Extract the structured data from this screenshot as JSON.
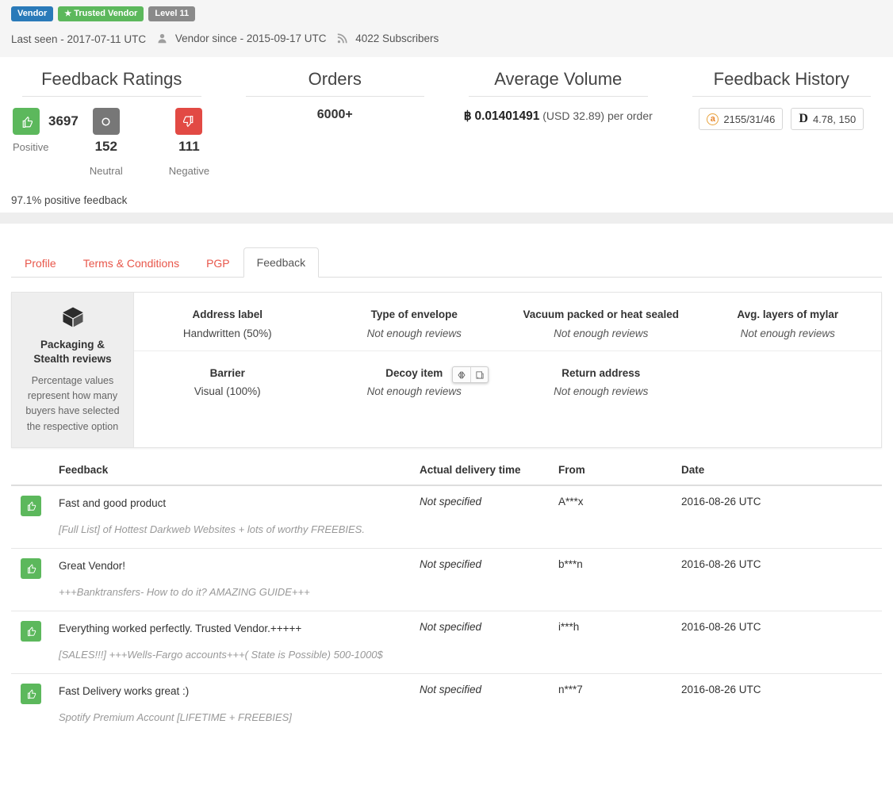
{
  "header": {
    "badges": [
      {
        "label": "Vendor",
        "kind": "vendor"
      },
      {
        "label": "Trusted Vendor",
        "kind": "trusted"
      },
      {
        "label": "Level 11",
        "kind": "level"
      }
    ],
    "last_seen": "Last seen - 2017-07-11 UTC",
    "vendor_since": "Vendor since - 2015-09-17 UTC",
    "subscribers": "4022 Subscribers"
  },
  "stats": {
    "feedback_ratings": {
      "title": "Feedback Ratings",
      "positive_count": "3697",
      "positive_label": "Positive",
      "neutral_count": "152",
      "neutral_label": "Neutral",
      "negative_count": "111",
      "negative_label": "Negative",
      "summary": "97.1% positive feedback"
    },
    "orders": {
      "title": "Orders",
      "value": "6000+"
    },
    "average_volume": {
      "title": "Average Volume",
      "btc_symbol": "฿",
      "btc_amount": "0.01401491",
      "usd": "(USD 32.89) per order"
    },
    "feedback_history": {
      "title": "Feedback History",
      "entries": [
        {
          "market": "a",
          "value": "2155/31/46"
        },
        {
          "market": "D",
          "value": "4.78, 150"
        }
      ]
    }
  },
  "tabs": [
    {
      "label": "Profile",
      "active": false
    },
    {
      "label": "Terms & Conditions",
      "active": false
    },
    {
      "label": "PGP",
      "active": false
    },
    {
      "label": "Feedback",
      "active": true
    }
  ],
  "packaging": {
    "side_title": "Packaging & Stealth reviews",
    "side_desc": "Percentage values represent how many buyers have selected the respective option",
    "row1": [
      {
        "head": "Address label",
        "value": "Handwritten (50%)",
        "na": false
      },
      {
        "head": "Type of envelope",
        "value": "Not enough reviews",
        "na": true
      },
      {
        "head": "Vacuum packed or heat sealed",
        "value": "Not enough reviews",
        "na": true
      },
      {
        "head": "Avg. layers of mylar",
        "value": "Not enough reviews",
        "na": true
      }
    ],
    "row2": [
      {
        "head": "Barrier",
        "value": "Visual (100%)",
        "na": false
      },
      {
        "head": "Decoy item",
        "value": "Not enough reviews",
        "na": true
      },
      {
        "head": "Return address",
        "value": "Not enough reviews",
        "na": true
      },
      {
        "head": "",
        "value": "",
        "na": false
      }
    ]
  },
  "feedback_table": {
    "columns": [
      "Feedback",
      "Actual delivery time",
      "From",
      "Date"
    ],
    "rows": [
      {
        "rating": "positive",
        "message": "Fast and good product",
        "product": "[Full List] of Hottest Darkweb Websites + lots of worthy FREEBIES.",
        "delivery": "Not specified",
        "from": "A***x",
        "date": "2016-08-26 UTC"
      },
      {
        "rating": "positive",
        "message": "Great Vendor!",
        "product": "+++Banktransfers- How to do it? AMAZING GUIDE+++",
        "delivery": "Not specified",
        "from": "b***n",
        "date": "2016-08-26 UTC"
      },
      {
        "rating": "positive",
        "message": "Everything worked perfectly. Trusted Vendor.+++++",
        "product": "[SALES!!!] +++Wells-Fargo accounts+++( State is Possible) 500-1000$",
        "delivery": "Not specified",
        "from": "i***h",
        "date": "2016-08-26 UTC"
      },
      {
        "rating": "positive",
        "message": "Fast Delivery works great :)",
        "product": "Spotify Premium Account [LIFETIME + FREEBIES]",
        "delivery": "Not specified",
        "from": "n***7",
        "date": "2016-08-26 UTC"
      }
    ]
  },
  "colors": {
    "blue": "#2a7ab9",
    "green": "#5cb85c",
    "gray": "#8a8a8a",
    "red": "#e24a44",
    "tab_link": "#e8564a"
  }
}
